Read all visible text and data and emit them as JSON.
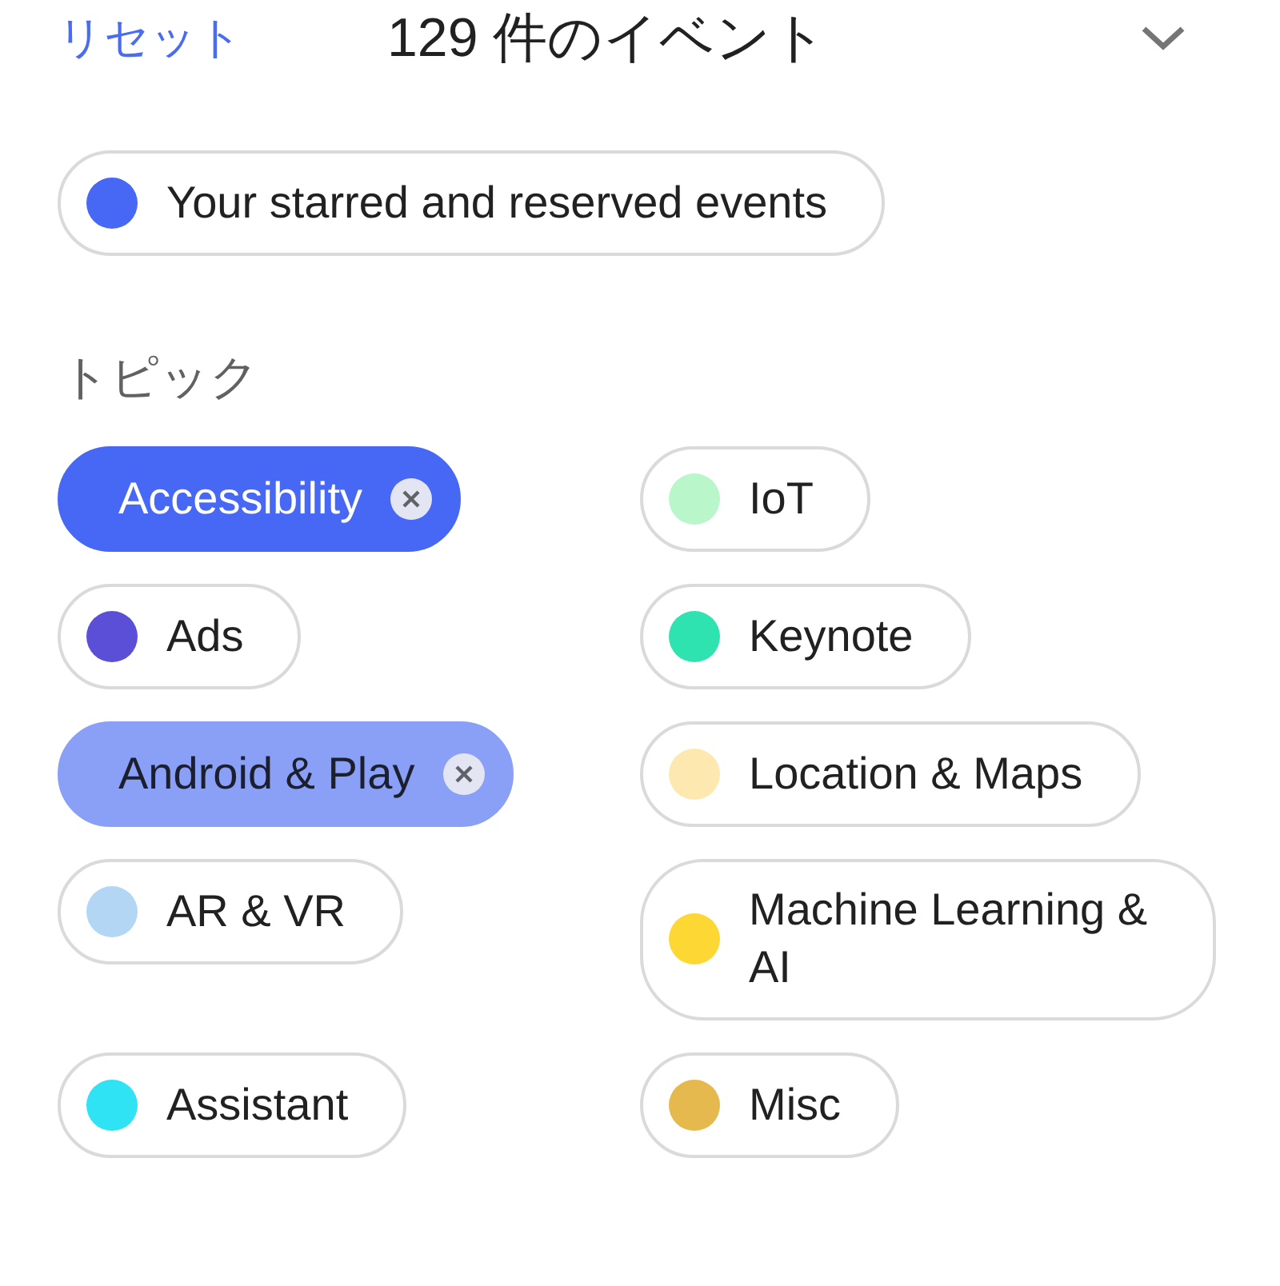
{
  "header": {
    "reset_link": "リセット",
    "event_count": "129 件のイベント"
  },
  "starred_filter": {
    "label": "Your starred and reserved events",
    "color": "#4768f5",
    "selected": false
  },
  "topics": {
    "heading": "トピック",
    "items": [
      {
        "label": "Accessibility",
        "color": "#4768f5",
        "selected": true
      },
      {
        "label": "IoT",
        "color": "#b9f6ca",
        "selected": false
      },
      {
        "label": "Ads",
        "color": "#5a4fd6",
        "selected": false
      },
      {
        "label": "Keynote",
        "color": "#2fe3b0",
        "selected": false
      },
      {
        "label": "Android & Play",
        "color": "#8aa0f7",
        "selected": true
      },
      {
        "label": "Location & Maps",
        "color": "#fde9b0",
        "selected": false
      },
      {
        "label": "AR & VR",
        "color": "#b3d6f5",
        "selected": false
      },
      {
        "label": "Machine Learning & AI",
        "color": "#fdd835",
        "selected": false
      },
      {
        "label": "Assistant",
        "color": "#2fe3f5",
        "selected": false
      },
      {
        "label": "Misc",
        "color": "#e5b94e",
        "selected": false
      }
    ]
  }
}
